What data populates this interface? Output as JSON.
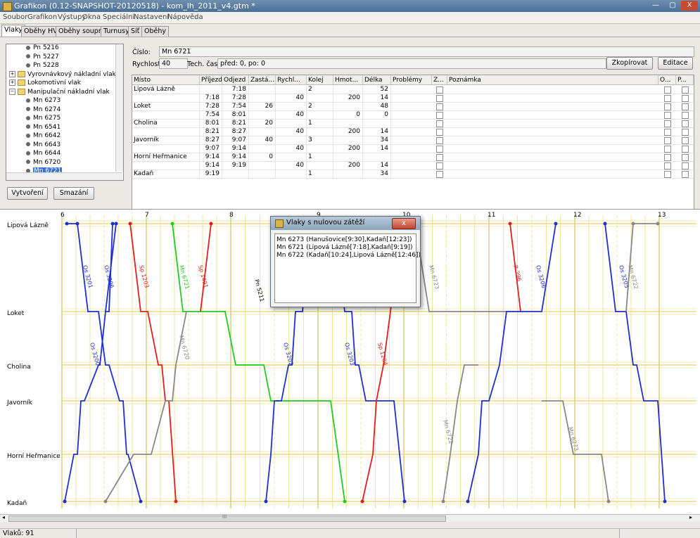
{
  "window": {
    "title": "Grafikon (0.12-SNAPSHOT-20120518) - kom_lh_2011_v4.gtm *",
    "minimize": "—",
    "maximize": "▢",
    "close": "X"
  },
  "menu": [
    "Soubor",
    "Grafikon",
    "Výstupy",
    "Okna",
    "Speciální",
    "Nastavení",
    "Nápověda"
  ],
  "tabs": [
    "Vlaky",
    "Oběhy HV",
    "Oběhy souprav",
    "Turnusy",
    "Síť",
    "Oběhy"
  ],
  "tree": [
    {
      "label": "Pn 5216",
      "type": "leaf"
    },
    {
      "label": "Pn 5227",
      "type": "leaf"
    },
    {
      "label": "Pn 5228",
      "type": "leaf"
    },
    {
      "label": "Vyrovnávkový nákladní vlak",
      "type": "group"
    },
    {
      "label": "Lokomotivní vlak",
      "type": "group"
    },
    {
      "label": "Manipulační nákladní vlak",
      "type": "group-open"
    },
    {
      "label": "Mn 6273",
      "type": "leaf"
    },
    {
      "label": "Mn 6274",
      "type": "leaf"
    },
    {
      "label": "Mn 6275",
      "type": "leaf"
    },
    {
      "label": "Mn 6541",
      "type": "leaf"
    },
    {
      "label": "Mn 6642",
      "type": "leaf"
    },
    {
      "label": "Mn 6643",
      "type": "leaf"
    },
    {
      "label": "Mn 6644",
      "type": "leaf"
    },
    {
      "label": "Mn 6720",
      "type": "leaf"
    },
    {
      "label": "Mn 6721",
      "type": "leaf-selected"
    }
  ],
  "buttons": {
    "create": "Vytvoření",
    "delete": "Smazání",
    "copy": "Zkopírovat",
    "edit": "Editace"
  },
  "form": {
    "cislo_label": "Číslo:",
    "cislo_value": "Mn 6721",
    "rychlost_label": "Rychlost:",
    "rychlost_value": "40",
    "tech_label": "Tech. časy:",
    "tech_value": "před: 0, po: 0"
  },
  "table": {
    "headers": [
      "Místo",
      "Příjezd",
      "Odjezd",
      "Zastá...",
      "Rychl...",
      "Kolej",
      "Hmot...",
      "Délka",
      "Problémy",
      "Z...",
      "Poznámka",
      "O...",
      "P..."
    ],
    "rows": [
      [
        "Lipová Lázně",
        "",
        "7:18",
        "",
        "",
        "2",
        "",
        "52"
      ],
      [
        "",
        "7:18",
        "7:28",
        "",
        "40",
        "",
        "200",
        "14"
      ],
      [
        "Loket",
        "7:28",
        "7:54",
        "26",
        "",
        "2",
        "",
        "48"
      ],
      [
        "",
        "7:54",
        "8:01",
        "",
        "40",
        "",
        "0",
        "0"
      ],
      [
        "Cholina",
        "8:01",
        "8:21",
        "20",
        "",
        "1",
        "",
        ""
      ],
      [
        "",
        "8:21",
        "8:27",
        "",
        "40",
        "",
        "200",
        "14"
      ],
      [
        "Javorník",
        "8:27",
        "9:07",
        "40",
        "",
        "3",
        "",
        "34"
      ],
      [
        "",
        "9:07",
        "9:14",
        "",
        "40",
        "",
        "200",
        "14"
      ],
      [
        "Horní Heřmanice",
        "9:14",
        "9:14",
        "0",
        "",
        "1",
        "",
        ""
      ],
      [
        "",
        "9:14",
        "9:19",
        "",
        "40",
        "",
        "200",
        "14"
      ],
      [
        "Kadaň",
        "9:19",
        "",
        "",
        "",
        "1",
        "",
        "34"
      ]
    ]
  },
  "graph": {
    "hours": [
      "6",
      "7",
      "8",
      "9",
      "10",
      "11",
      "12",
      "13"
    ],
    "stations": [
      "Lipová Lázně",
      "Loket",
      "Cholina",
      "Javorník",
      "Horní Heřmanice",
      "Kadaň"
    ],
    "train_labels": [
      "Os 3201",
      "Os 3200",
      "Os 3206",
      "Sp 1203",
      "Mn 6721",
      "Sp 1491",
      "Mn 6720",
      "Os 3202",
      "Os 3203",
      "Sp 1204",
      "Mn 6723",
      "R 296",
      "Os 3205",
      "Mn 6722",
      "Mn 6273",
      "Pn 5211"
    ]
  },
  "dialog": {
    "title": "Vlaky s nulovou zátěží",
    "close": "x",
    "items": [
      "Mn 6273 (Hanušovice[9:30],Kadaň[12:23])",
      "Mn 6721 (Lipová Lázně[7:18],Kadaň[9:19])",
      "Mn 6722 (Kadaň[10:24],Lipová Lázně[12:46])"
    ]
  },
  "status": {
    "count": "Vlaků: 91"
  },
  "scrollbar_grip": "III",
  "colors": {
    "os": "#1f2fd0",
    "sp": "#e02020",
    "mn": "#888888",
    "mn_zero": "#22cc22",
    "grid": "#e8d36a"
  }
}
